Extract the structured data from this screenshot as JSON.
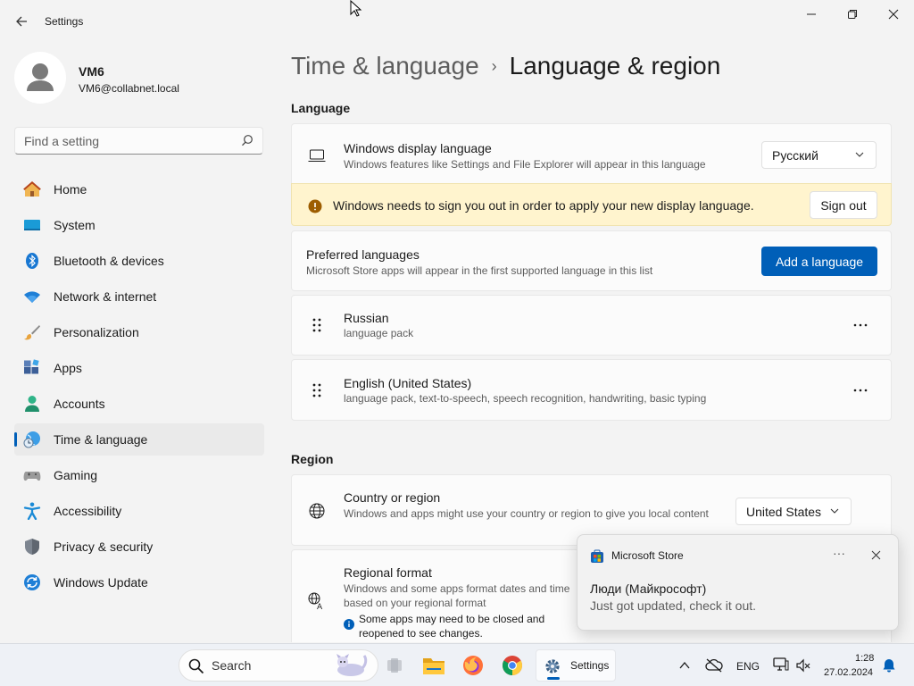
{
  "window": {
    "title": "Settings",
    "back_icon": "back-arrow-icon",
    "minimize_icon": "minimize-icon",
    "restore_icon": "restore-icon",
    "close_icon": "close-icon"
  },
  "user": {
    "name": "VM6",
    "email": "VM6@collabnet.local"
  },
  "search": {
    "placeholder": "Find a setting"
  },
  "nav": {
    "items": [
      {
        "label": "Home",
        "icon": "home-icon"
      },
      {
        "label": "System",
        "icon": "system-icon"
      },
      {
        "label": "Bluetooth & devices",
        "icon": "bluetooth-icon"
      },
      {
        "label": "Network & internet",
        "icon": "wifi-icon"
      },
      {
        "label": "Personalization",
        "icon": "brush-icon"
      },
      {
        "label": "Apps",
        "icon": "apps-icon"
      },
      {
        "label": "Accounts",
        "icon": "accounts-icon"
      },
      {
        "label": "Time & language",
        "icon": "time-language-icon",
        "active": true
      },
      {
        "label": "Gaming",
        "icon": "gamepad-icon"
      },
      {
        "label": "Accessibility",
        "icon": "accessibility-icon"
      },
      {
        "label": "Privacy & security",
        "icon": "shield-icon"
      },
      {
        "label": "Windows Update",
        "icon": "update-icon"
      }
    ]
  },
  "breadcrumb": {
    "parent": "Time & language",
    "separator": "›",
    "current": "Language & region"
  },
  "language_section": {
    "heading": "Language",
    "display_language": {
      "title": "Windows display language",
      "desc": "Windows features like Settings and File Explorer will appear in this language",
      "value": "Русский"
    },
    "warning": {
      "text": "Windows needs to sign you out in order to apply your new display language.",
      "button": "Sign out"
    },
    "preferred": {
      "title": "Preferred languages",
      "desc": "Microsoft Store apps will appear in the first supported language in this list",
      "button": "Add a language"
    },
    "languages": [
      {
        "name": "Russian",
        "features": "language pack"
      },
      {
        "name": "English (United States)",
        "features": "language pack, text-to-speech, speech recognition, handwriting, basic typing"
      }
    ]
  },
  "region_section": {
    "heading": "Region",
    "country": {
      "title": "Country or region",
      "desc": "Windows and apps might use your country or region to give you local content",
      "value": "United States"
    },
    "format": {
      "title": "Regional format",
      "desc": "Windows and some apps format dates and time based on your regional format",
      "note": "Some apps may need to be closed and reopened to see changes."
    }
  },
  "toast": {
    "app": "Microsoft Store",
    "more": "···",
    "title": "Люди (Майкрософт)",
    "body": "Just got updated, check it out."
  },
  "taskbar": {
    "search_label": "Search",
    "settings_label": "Settings",
    "language": "ENG",
    "time": "1:28",
    "date": "27.02.2024"
  },
  "colors": {
    "accent": "#005fb8",
    "warning_bg": "#fff4ce",
    "warning_icon": "#9d5d00"
  }
}
